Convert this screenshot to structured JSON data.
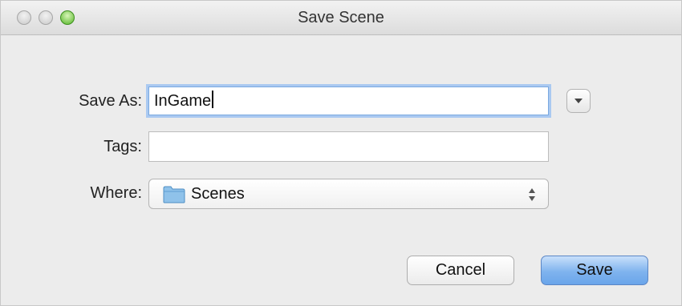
{
  "window": {
    "title": "Save Scene"
  },
  "form": {
    "save_as_label": "Save As:",
    "save_as_value": "InGame",
    "tags_label": "Tags:",
    "tags_value": "",
    "where_label": "Where:",
    "where_value": "Scenes"
  },
  "buttons": {
    "cancel": "Cancel",
    "save": "Save"
  },
  "icons": {
    "disclosure": "chevron-down-icon",
    "where_folder": "folder-icon",
    "where_stepper": "up-down-stepper-icon"
  },
  "colors": {
    "default_button": "#7fb3ee",
    "focus_ring": "#aac9f1",
    "zoom_button": "#54b526"
  }
}
